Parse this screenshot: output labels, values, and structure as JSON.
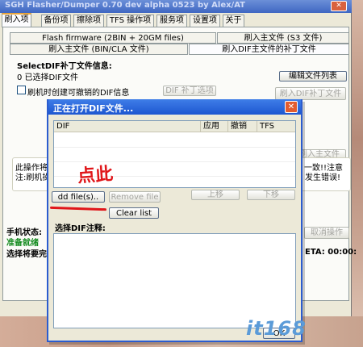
{
  "window": {
    "title": "SGH Flasher/Dumper 0.70 dev alpha 0523 by Alex/AT",
    "close": "✕"
  },
  "tabs": [
    "刷入项",
    "备份项",
    "擦除项",
    "TFS 操作项",
    "服务项",
    "设置项",
    "关于"
  ],
  "subtabs": {
    "flash_firmware": "Flash firmware (2BIN + 20GM files)",
    "main_file_s3": "刷入主文件 (S3 文件)",
    "main_file_bin": "刷入主文件 (BIN/CLA 文件)",
    "dif_patch": "刷入DIF主文件的补丁文件"
  },
  "dif_info": {
    "label": "SelectDIF补丁文件信息:",
    "status": "0 已选择DIF文件",
    "edit_list_button": "编辑文件列表",
    "undo_checkbox_label": "刷机时创建可撤销的DIF信息",
    "dif_patch_option_button": "DIF 补丁选项",
    "flash_dif_button": "刷入DIF补丁文件",
    "flash_main_button": "刷入主文件"
  },
  "info_box": {
    "line1": "此操作将",
    "line1_right": "一致!!注意",
    "line2": "注:刷机操",
    "line2_right": "发生错误!"
  },
  "status_area": {
    "phone_status_label": "手机状态:",
    "ready": "准备就绪",
    "cancel_button": "取消操作",
    "select_label": "选择将要完",
    "eta_label": "ETA: 00:00:"
  },
  "dialog": {
    "title": "正在打开DIF文件...",
    "close": "✕",
    "columns": [
      "DIF",
      "应用",
      "撤销",
      "TFS"
    ],
    "add_files_button": "dd file(s)..",
    "remove_file_button": "Remove file",
    "move_up_button": "上移",
    "move_down_button": "下移",
    "clear_list_button": "Clear list",
    "notes_label": "选择DIF注释:",
    "ok_button": "OK"
  },
  "annotation": {
    "text": "点此",
    "color": "#e0161a"
  },
  "watermark": {
    "text": "it168",
    "color": "#5b9bd8"
  }
}
